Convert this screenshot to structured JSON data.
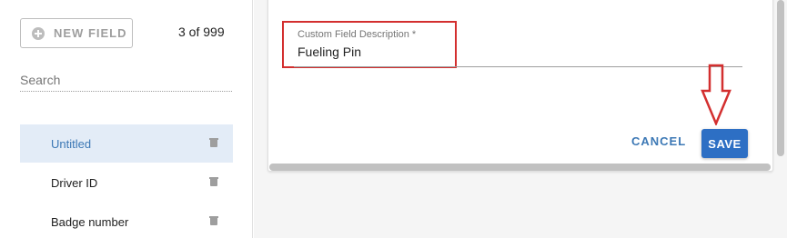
{
  "sidebar": {
    "new_field_label": "NEW FIELD",
    "count_text": "3 of 999",
    "search_placeholder": "Search",
    "items": [
      {
        "label": "Untitled",
        "selected": true
      },
      {
        "label": "Driver ID",
        "selected": false
      },
      {
        "label": "Badge number",
        "selected": false
      }
    ]
  },
  "form": {
    "field_label": "Custom Field Description *",
    "field_value": "Fueling Pin",
    "cancel_label": "CANCEL",
    "save_label": "SAVE"
  },
  "colors": {
    "accent": "#2d6fc4",
    "selected_bg": "#e3ecf7",
    "annotation_red": "#d32f2f"
  },
  "icons": [
    "plus-circle-icon",
    "trash-icon",
    "down-arrow-annotation-icon"
  ]
}
